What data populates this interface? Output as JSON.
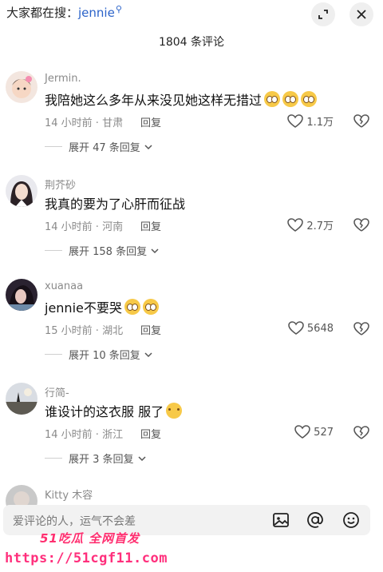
{
  "header": {
    "search_prefix": "大家都在搜：",
    "search_keyword": "jennie",
    "title": "1804 条评论"
  },
  "comments": [
    {
      "user": "Jermin.",
      "text": "我陪她这么多年从来没见她这样无措过",
      "emoji_count": 3,
      "time_loc": "14 小时前 · 甘肃",
      "reply": "回复",
      "likes": "1.1万",
      "expand": "展开 47 条回复"
    },
    {
      "user": "荆芥砂",
      "text": "我真的要为了心肝而征战",
      "emoji_count": 0,
      "time_loc": "14 小时前 · 河南",
      "reply": "回复",
      "likes": "2.7万",
      "expand": "展开 158 条回复"
    },
    {
      "user": "xuanaa",
      "text": "jennie不要哭",
      "emoji_count": 2,
      "time_loc": "15 小时前 · 湖北",
      "reply": "回复",
      "likes": "5648",
      "expand": "展开 10 条回复"
    },
    {
      "user": "行简-",
      "text": "谁设计的这衣服 服了",
      "emoji_count": 1,
      "time_loc": "14 小时前 · 浙江",
      "reply": "回复",
      "likes": "527",
      "expand": "展开 3 条回复"
    },
    {
      "user": "Kitty 木容"
    }
  ],
  "input": {
    "placeholder": "爱评论的人，运气不会差"
  },
  "watermark": {
    "brand": "51吃瓜 全网首发",
    "url": "https://51cgf11.com"
  },
  "icons": [
    "search-icon",
    "minimize-icon",
    "close-icon",
    "heart-icon",
    "dislike-icon",
    "chevron-down-icon",
    "image-icon",
    "at-icon",
    "emoji-icon"
  ]
}
